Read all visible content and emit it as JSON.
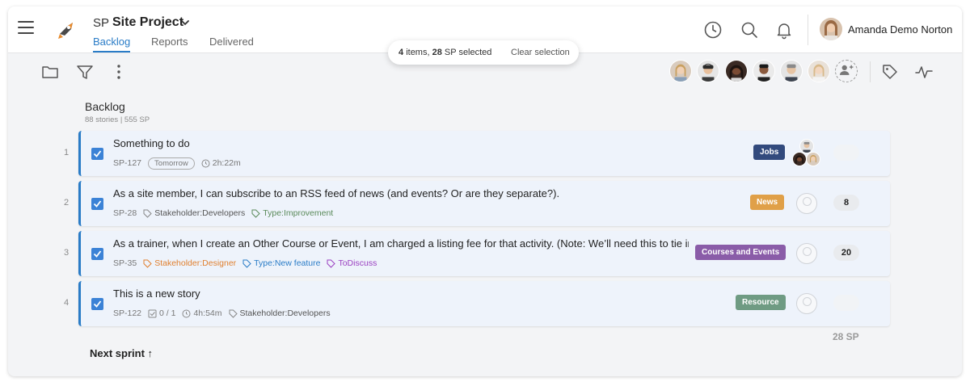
{
  "header": {
    "project_key": "SP",
    "project_name": "Site Project",
    "tabs": [
      "Backlog",
      "Reports",
      "Delivered"
    ],
    "user_name": "Amanda Demo Norton"
  },
  "selection": {
    "count": "4",
    "items_word": "items,",
    "sp": "28",
    "sp_suffix": "SP selected",
    "clear_label": "Clear selection"
  },
  "backlog": {
    "title": "Backlog",
    "subtitle": "88 stories | 555 SP",
    "total": "28 SP",
    "next_sprint": "Next sprint ↑"
  },
  "stories": [
    {
      "num": "1",
      "title": "Something to do",
      "id": "SP-127",
      "due": "Tomorrow",
      "time": "2h:22m",
      "label": "Jobs",
      "label_color": "#324a7d",
      "sp": ""
    },
    {
      "num": "2",
      "title": "As a site member, I can subscribe to an RSS feed of news (and events? Or are they separate?).",
      "id": "SP-28",
      "tags": [
        {
          "text": "Stakeholder:Developers",
          "color": "#555555"
        },
        {
          "text": "Type:Improvement",
          "color": "#5a8a5a"
        }
      ],
      "label": "News",
      "label_color": "#e0a048",
      "sp": "8"
    },
    {
      "num": "3",
      "title": "As a trainer, when I create an Other Course or Event, I am charged a listing fee for that activity. (Note: We’ll need this to tie into ...",
      "id": "SP-35",
      "tags": [
        {
          "text": "Stakeholder:Designer",
          "color": "#e08030"
        },
        {
          "text": "Type:New feature",
          "color": "#2a7cc7"
        },
        {
          "text": "ToDiscuss",
          "color": "#9a3fc0"
        }
      ],
      "label": "Courses and Events",
      "label_color": "#8a5ca8",
      "sp": "20"
    },
    {
      "num": "4",
      "title": "This is a new story",
      "id": "SP-122",
      "tasks": "0 / 1",
      "time": "4h:54m",
      "tags": [
        {
          "text": "Stakeholder:Developers",
          "color": "#555555"
        }
      ],
      "label": "Resource",
      "label_color": "#6f9b83",
      "sp": ""
    }
  ]
}
